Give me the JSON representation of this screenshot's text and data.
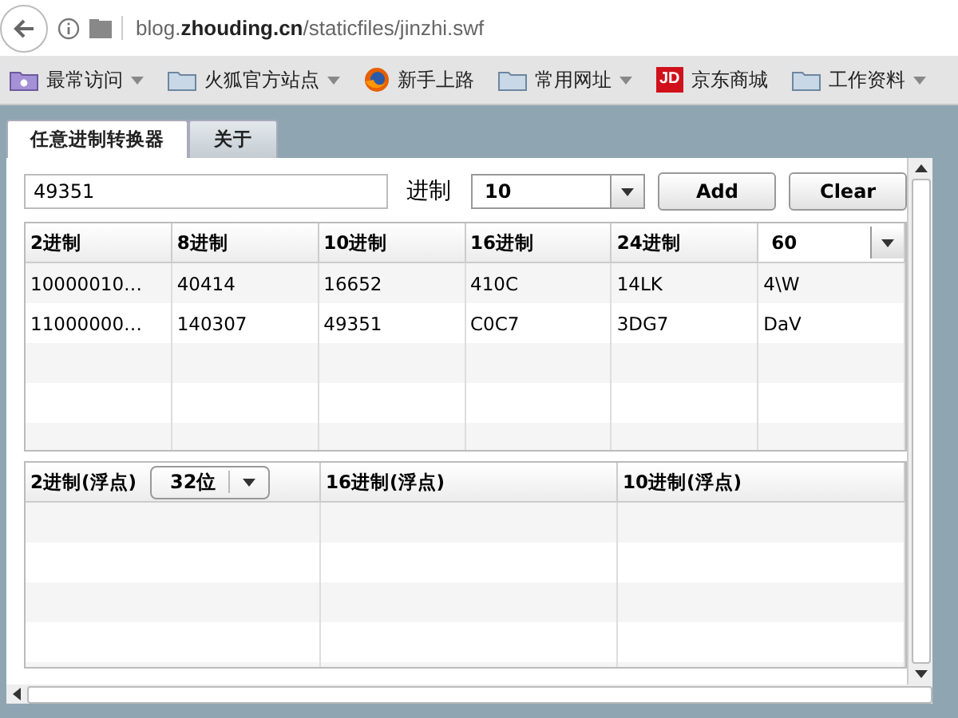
{
  "browser": {
    "address": "blog.**zhouding.cn**/staticfiles/jinzhi.swf"
  },
  "bookmarks": [
    {
      "label": "最常访问",
      "kind": "special",
      "dropdown": true
    },
    {
      "label": "火狐官方站点",
      "kind": "folder",
      "dropdown": true
    },
    {
      "label": "新手上路",
      "kind": "firefox",
      "dropdown": false
    },
    {
      "label": "常用网址",
      "kind": "folder",
      "dropdown": true
    },
    {
      "label": "京东商城",
      "kind": "jd",
      "badge": "JD",
      "dropdown": false
    },
    {
      "label": "工作资料",
      "kind": "folder",
      "dropdown": true
    }
  ],
  "tabs": [
    {
      "label": "任意进制转换器",
      "selected": true
    },
    {
      "label": "关于",
      "selected": false
    }
  ],
  "input": {
    "value": "49351"
  },
  "base_label": "进制",
  "base_select": {
    "value": "10"
  },
  "buttons": [
    "Add",
    "Clear"
  ],
  "table": {
    "columns": [
      {
        "kind": "text",
        "label": "2进制"
      },
      {
        "kind": "text",
        "label": "8进制"
      },
      {
        "kind": "text",
        "label": "10进制"
      },
      {
        "kind": "text",
        "label": "16进制"
      },
      {
        "kind": "text",
        "label": "24进制"
      },
      {
        "kind": "select",
        "label": "60"
      }
    ],
    "rows": [
      [
        "10000010…",
        "40414",
        "16652",
        "410C",
        "14LK",
        "4\\W"
      ],
      [
        "11000000…",
        "140307",
        "49351",
        "C0C7",
        "3DG7",
        "DaV"
      ]
    ]
  },
  "float_table": {
    "columns": [
      {
        "label": "2进制(浮点)",
        "select": "32位"
      },
      {
        "label": "16进制(浮点)"
      },
      {
        "label": "10进制(浮点)"
      }
    ]
  }
}
